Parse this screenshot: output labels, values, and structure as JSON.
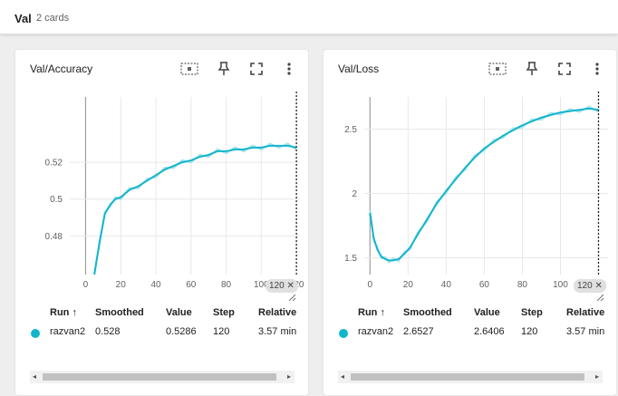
{
  "group": {
    "title": "Val",
    "count": "2 cards"
  },
  "cards": [
    {
      "title": "Val/Accuracy",
      "step_badge": "120",
      "table": {
        "headers": {
          "run": "Run ↑",
          "smoothed": "Smoothed",
          "value": "Value",
          "step": "Step",
          "relative": "Relative"
        },
        "row": {
          "run": "razvan2",
          "smoothed": "0.528",
          "value": "0.5286",
          "step": "120",
          "relative": "3.57 min"
        }
      }
    },
    {
      "title": "Val/Loss",
      "step_badge": "120",
      "table": {
        "headers": {
          "run": "Run ↑",
          "smoothed": "Smoothed",
          "value": "Value",
          "step": "Step",
          "relative": "Relative"
        },
        "row": {
          "run": "razvan2",
          "smoothed": "2.6527",
          "value": "2.6406",
          "step": "120",
          "relative": "3.57 min"
        }
      }
    }
  ],
  "colors": {
    "series": "#12b5cb",
    "raw": "#a7e4ec"
  },
  "icons": [
    "fit-domain-icon",
    "pin-icon",
    "fullscreen-icon",
    "more-vert-icon"
  ],
  "chart_data": [
    {
      "type": "line",
      "xlabel": "",
      "ylabel": "",
      "x_ticks": [
        0,
        20,
        40,
        60,
        80,
        100,
        120
      ],
      "y_ticks": [
        0.48,
        0.5,
        0.52
      ],
      "xlim": [
        -9,
        122
      ],
      "ylim": [
        0.459,
        0.5555
      ],
      "series": [
        {
          "name": "razvan2",
          "x": [
            5,
            8,
            11,
            14,
            17,
            20,
            25,
            30,
            35,
            40,
            45,
            50,
            55,
            60,
            65,
            70,
            75,
            80,
            85,
            90,
            95,
            100,
            105,
            110,
            115,
            120
          ],
          "smoothed": [
            0.459,
            0.477,
            0.492,
            0.497,
            0.5,
            0.501,
            0.505,
            0.507,
            0.51,
            0.513,
            0.516,
            0.518,
            0.52,
            0.521,
            0.523,
            0.524,
            0.526,
            0.526,
            0.527,
            0.527,
            0.528,
            0.528,
            0.529,
            0.529,
            0.529,
            0.528
          ]
        }
      ]
    },
    {
      "type": "line",
      "xlabel": "",
      "ylabel": "",
      "x_ticks": [
        0,
        20,
        40,
        60,
        80,
        100,
        120
      ],
      "y_ticks": [
        1.5,
        2,
        2.5
      ],
      "xlim": [
        -3,
        125
      ],
      "ylim": [
        1.37,
        2.75
      ],
      "series": [
        {
          "name": "razvan2",
          "x": [
            0,
            2,
            4,
            6,
            8,
            10,
            12,
            15,
            18,
            21,
            25,
            30,
            35,
            40,
            45,
            50,
            55,
            60,
            65,
            70,
            75,
            80,
            85,
            90,
            95,
            100,
            105,
            110,
            115,
            120
          ],
          "smoothed": [
            1.85,
            1.65,
            1.56,
            1.51,
            1.49,
            1.48,
            1.48,
            1.49,
            1.53,
            1.58,
            1.68,
            1.8,
            1.92,
            2.02,
            2.11,
            2.2,
            2.28,
            2.35,
            2.4,
            2.45,
            2.49,
            2.53,
            2.56,
            2.59,
            2.61,
            2.63,
            2.64,
            2.65,
            2.66,
            2.65
          ]
        }
      ]
    }
  ]
}
